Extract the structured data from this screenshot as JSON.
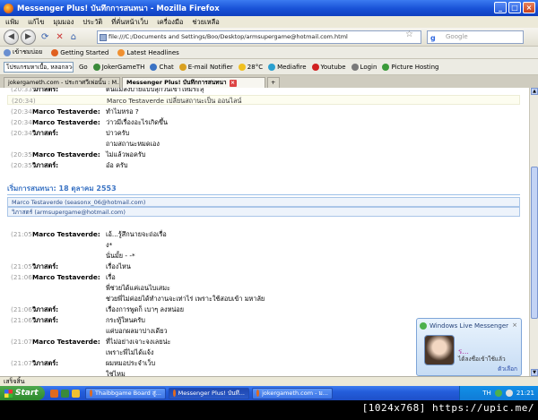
{
  "window": {
    "title": "Messenger Plus! บันทึกการสนทนา - Mozilla Firefox",
    "controls": [
      "_",
      "□",
      "×"
    ]
  },
  "menu": [
    "แฟ้ม",
    "แก้ไข",
    "มุมมอง",
    "ประวัติ",
    "ที่คั่นหน้าเว็บ",
    "เครื่องมือ",
    "ช่วยเหลือ"
  ],
  "nav": {
    "back": "◀",
    "forward": "▶",
    "url": "file:///C:/Documents and Settings/Boo/Desktop/armsupergame@hotmail.com.html",
    "search_placeholder": "Google"
  },
  "bookmarks": [
    "เข้าชมบ่อย",
    "Getting Started",
    "Latest Headlines"
  ],
  "toolbar": {
    "search_value": "โปรแกรมหาเบื้อ, หลอกลวง",
    "go": "Go",
    "items": [
      "JokerGameTH",
      "Chat",
      "E-mail Notifier",
      "28°C",
      "Mediafire",
      "Youtube",
      "Login",
      "Picture Hosting"
    ]
  },
  "tabs": [
    {
      "label": "jokergameth.com - ประกาศวีเพ่อนั้น : M..."
    },
    {
      "label": "Messenger Plus! บันทึกการสนทนา"
    }
  ],
  "log_top": [
    {
      "time": "(20:33)",
      "name": "วิภาสตร์:",
      "msg": "ต้นแมลงบายแบปลุกวันเขาใหม่ระลุ"
    },
    {
      "time": "(20:34)",
      "name": "",
      "msg": "Marco Testaverde เปลี่ยนสถานะเป็น ออนไลน์"
    },
    {
      "time": "(20:34)",
      "name": "Marco Testaverde:",
      "msg": "ทำไมหรอ ?"
    },
    {
      "time": "(20:34)",
      "name": "Marco Testaverde:",
      "msg": "ว่าวมีเรื่องอะไรเกิดขึ้น"
    },
    {
      "time": "(20:34)",
      "name": "วิภาสตร์:",
      "msg": "ปาวครับ"
    },
    {
      "time": "",
      "name": "",
      "msg": "ถามสถานะหมดเอง"
    },
    {
      "time": "(20:35)",
      "name": "Marco Testaverde:",
      "msg": "ไม่แล้วพอครับ"
    },
    {
      "time": "(20:35)",
      "name": "วิภาสตร์:",
      "msg": "อ๋อ ครับ"
    }
  ],
  "session": {
    "header": "เริ่มการสนทนา: 18 ตุลาคม 2553",
    "participants": [
      "Marco Testaverde (seasonx_06@hotmail.com)",
      "วิภาสตร์ (armsupergame@hotmail.com)"
    ]
  },
  "log_bottom": [
    {
      "time": "(21:05)",
      "name": "Marco Testaverde:",
      "msg": "เอ้...รู้สึกนายจะถ่อเรื่อ"
    },
    {
      "time": "",
      "name": "",
      "msg": "ง*"
    },
    {
      "time": "",
      "name": "",
      "msg": "นั่นมั้ย - -*"
    },
    {
      "time": "(21:05)",
      "name": "วิภาสตร์:",
      "msg": "เรื่องไหน"
    },
    {
      "time": "(21:06)",
      "name": "Marco Testaverde:",
      "msg": "เรื่อ"
    },
    {
      "time": "",
      "name": "",
      "msg": "พี่ช่วยได้แค่เอนไบเสมะ"
    },
    {
      "time": "",
      "name": "",
      "msg": "ช่วยพี่ไม่ค่อยได้ทำงานจะเท่าไร่ เพราะใช้สอบเข้า มหาลัย"
    },
    {
      "time": "(21:06)",
      "name": "วิภาสตร์:",
      "msg": "เรื่องการพูดก็ เบาๆ ลงหน่อย"
    },
    {
      "time": "(21:06)",
      "name": "วิภาสตร์:",
      "msg": "กระทู้ใหนครับ"
    },
    {
      "time": "",
      "name": "",
      "msg": "แค่บอกผลมาบ่างเดียว"
    },
    {
      "time": "(21:07)",
      "name": "Marco Testaverde:",
      "msg": "ที่ไม่อย่างเจาะจงเลยน่ะ"
    },
    {
      "time": "",
      "name": "",
      "msg": "เพราะพี่ไม่ได้แจ้ง"
    },
    {
      "time": "(21:07)",
      "name": "วิภาสตร์:",
      "msg": "ผมหมอประจำเว็บ"
    },
    {
      "time": "",
      "name": "",
      "msg": "ใช่ไหม"
    },
    {
      "time": "(21:07)",
      "name": "Marco Testaverde:",
      "msg": "หมอประจำเว็บ ?"
    },
    {
      "time": "(21:07)",
      "name": "วิภาสตร์:",
      "msg": "ที่ถกรรม"
    }
  ],
  "statusbar": "เสร็จสิ้น",
  "notification": {
    "title": "Windows Live Messenger",
    "close": "×",
    "name": "ร...",
    "status": "ได้ลงชื่อเข้าใช้แล้ว",
    "options": "ตัวเลือก"
  },
  "taskbar": {
    "start": "Start",
    "tasks": [
      "Thaibbgame Board สู่...",
      "Messenger Plus! บันทึ...",
      "jokergameth.com - ม..."
    ],
    "lang": "TH",
    "time": "21:21"
  },
  "watermark": "[1024x768] https://upic.me/"
}
